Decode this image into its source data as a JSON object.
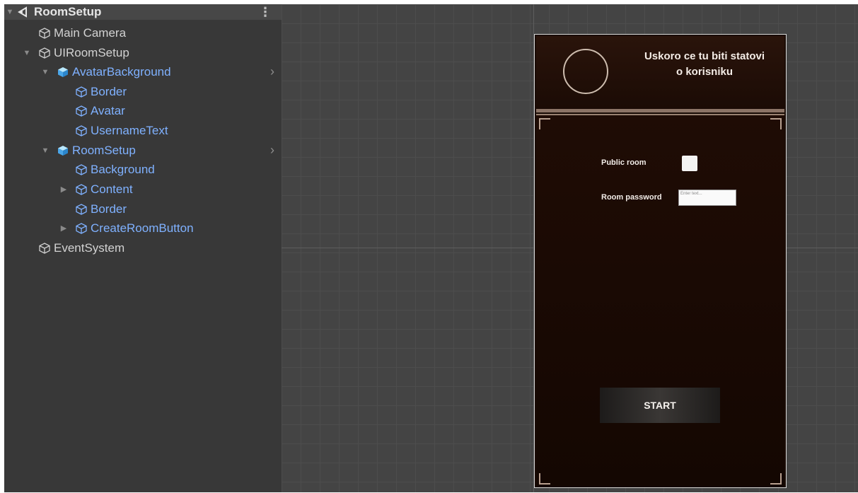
{
  "hierarchy": {
    "scene_name": "RoomSetup",
    "menu_icon": "kebab-menu-icon",
    "items": [
      {
        "label": "Main Camera",
        "prefab": false
      },
      {
        "label": "UIRoomSetup",
        "prefab": false
      },
      {
        "label": "AvatarBackground",
        "prefab": true
      },
      {
        "label": "Border",
        "prefab": true
      },
      {
        "label": "Avatar",
        "prefab": true
      },
      {
        "label": "UsernameText",
        "prefab": true
      },
      {
        "label": "RoomSetup",
        "prefab": true
      },
      {
        "label": "Background",
        "prefab": true
      },
      {
        "label": "Content",
        "prefab": true
      },
      {
        "label": "Border",
        "prefab": true
      },
      {
        "label": "CreateRoomButton",
        "prefab": true
      },
      {
        "label": "EventSystem",
        "prefab": false
      }
    ]
  },
  "game_ui": {
    "username_text": "Uskoro ce tu biti statovi o korisniku",
    "public_room_label": "Public room",
    "room_password_label": "Room password",
    "password_placeholder": "Enter text...",
    "start_button_label": "START"
  },
  "colors": {
    "hierarchy_bg": "#383838",
    "prefab_blue": "#7fb1ff",
    "scene_bg": "#444444",
    "canvas_bg": "#1a0c06"
  }
}
